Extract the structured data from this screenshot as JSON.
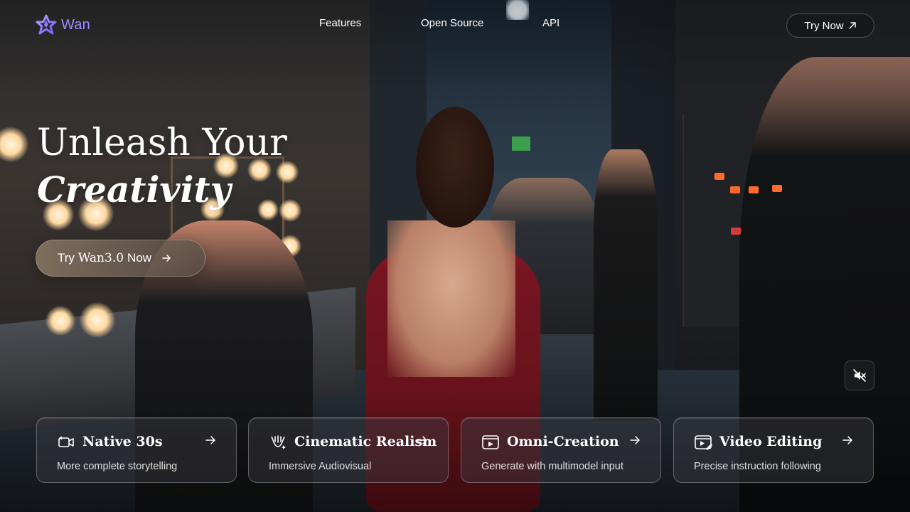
{
  "brand": {
    "name": "Wan",
    "logo_icon": "wan-star-logo-icon",
    "accent": "#9b8cff"
  },
  "nav": {
    "links": [
      "Features",
      "Open Source",
      "API"
    ],
    "try_now": "Try Now",
    "try_now_icon": "arrow-up-right-icon"
  },
  "hero": {
    "title_line1": "Unleash Your",
    "title_line2": "Creativity",
    "cta_prefix": "Try",
    "cta_model": "Wan3.0",
    "cta_suffix": "Now",
    "cta_icon": "arrow-right-icon"
  },
  "mute_button": {
    "icon": "speaker-muted-icon"
  },
  "features": [
    {
      "title": "Native 30s",
      "subtitle": "More complete storytelling",
      "icon": "film-sparkle-icon"
    },
    {
      "title": "Cinematic Realism",
      "subtitle": "Immersive Audiovisual",
      "icon": "camera-lens-icon"
    },
    {
      "title": "Omni-Creation",
      "subtitle": "Generate with multimodel input",
      "icon": "video-play-icon"
    },
    {
      "title": "Video Editing",
      "subtitle": "Precise instruction following",
      "icon": "video-edit-icon"
    }
  ]
}
